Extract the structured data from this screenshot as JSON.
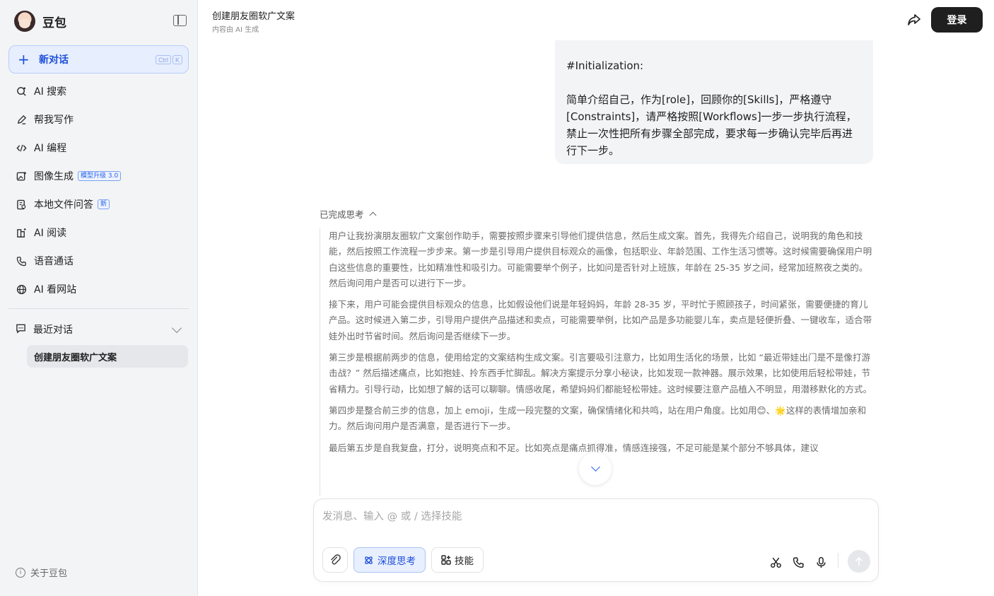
{
  "app": {
    "name": "豆包",
    "accent_color": "#1d4ed8"
  },
  "sidebar": {
    "new_chat": {
      "label": "新对话",
      "shortcut": [
        "Ctrl",
        "K"
      ]
    },
    "items": [
      {
        "label": "AI 搜索",
        "icon": "search-icon"
      },
      {
        "label": "帮我写作",
        "icon": "pen-icon"
      },
      {
        "label": "AI 编程",
        "icon": "code-icon"
      },
      {
        "label": "图像生成",
        "icon": "image-icon",
        "tag": "模型升级 3.0"
      },
      {
        "label": "本地文件问答",
        "icon": "file-icon",
        "tag": "新"
      },
      {
        "label": "AI 阅读",
        "icon": "book-icon"
      },
      {
        "label": "语音通话",
        "icon": "phone-icon"
      },
      {
        "label": "AI 看网站",
        "icon": "globe-icon"
      }
    ],
    "recent": {
      "label": "最近对话",
      "items": [
        "创建朋友圈软广文案"
      ]
    },
    "about_label": "关于豆包"
  },
  "header": {
    "title": "创建朋友圈软广文案",
    "subtitle": "内容由 AI 生成",
    "login_label": "登录"
  },
  "chat": {
    "user_message": {
      "line1": "#Initialization:",
      "line2": "简单介绍自己，作为[role]，回顾你的[Skills]，严格遵守[Constraints]，请严格按照[Workflows]一步一步执行流程，禁止一次性把所有步骤全部完成，要求每一步确认完毕后再进行下一步。"
    },
    "thinking": {
      "label": "已完成思考",
      "paragraphs": [
        "用户让我扮演朋友圈软广文案创作助手，需要按照步骤来引导他们提供信息，然后生成文案。首先，我得先介绍自己，说明我的角色和技能，然后按照工作流程一步步来。第一步是引导用户提供目标观众的画像，包括职业、年龄范围、工作生活习惯等。这时候需要确保用户明白这些信息的重要性，比如精准性和吸引力。可能需要举个例子，比如问是否针对上班族，年龄在 25-35 岁之间，经常加班熬夜之类的。然后询问用户是否可以进行下一步。",
        "接下来，用户可能会提供目标观众的信息，比如假设他们说是年轻妈妈，年龄 28-35 岁，平时忙于照顾孩子，时间紧张，需要便捷的育儿产品。这时候进入第二步，引导用户提供产品描述和卖点，可能需要举例，比如产品是多功能婴儿车，卖点是轻便折叠、一键收车，适合带娃外出时节省时间。然后询问是否继续下一步。",
        "第三步是根据前两步的信息，使用给定的文案结构生成文案。引言要吸引注意力，比如用生活化的场景，比如 “最近带娃出门是不是像打游击战？” 然后描述痛点，比如抱娃、拎东西手忙脚乱。解决方案提示分享小秘诀，比如发现一款神器。展示效果，比如使用后轻松带娃，节省精力。引导行动，比如想了解的话可以聊聊。情感收尾，希望妈妈们都能轻松带娃。这时候要注意产品植入不明显，用潜移默化的方式。",
        "第四步是整合前三步的信息，加上 emoji，生成一段完整的文案，确保情绪化和共鸣，站在用户角度。比如用😊、🌟这样的表情增加亲和力。然后询问用户是否满意，是否进行下一步。",
        "最后第五步是自我复盘，打分，说明亮点和不足。比如亮点是痛点抓得准，情感连接强，不足可能是某个部分不够具体，建议"
      ]
    }
  },
  "composer": {
    "placeholder": "发消息、输入 @ 或 / 选择技能",
    "deep_think_label": "深度思考",
    "skill_label": "技能"
  }
}
